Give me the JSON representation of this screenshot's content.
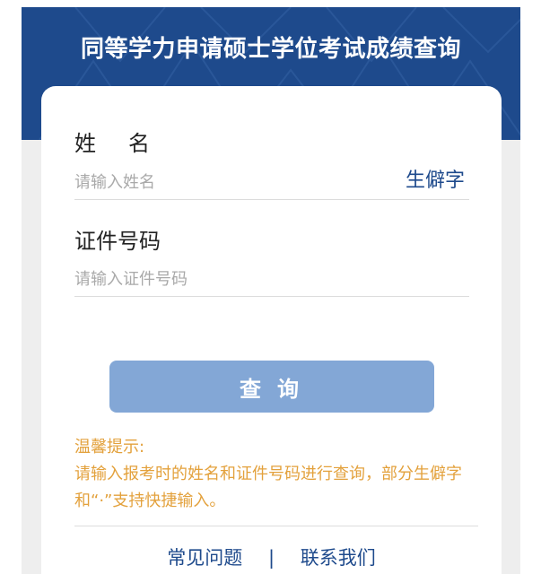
{
  "header": {
    "title": "同等学力申请硕士学位考试成绩查询"
  },
  "form": {
    "name_label": "姓名",
    "name_placeholder": "请输入姓名",
    "rare_char_label": "生僻字",
    "id_label": "证件号码",
    "id_placeholder": "请输入证件号码",
    "query_button": "查询"
  },
  "tips": {
    "title": "温馨提示:",
    "text": "请输入报考时的姓名和证件号码进行查询，部分生僻字和“·”支持快捷输入。"
  },
  "footer": {
    "faq": "常见问题",
    "separator": "|",
    "contact": "联系我们"
  },
  "colors": {
    "banner": "#1e4a8c",
    "button": "#83a7d6",
    "tip": "#e3a13c",
    "link": "#1e4a8c"
  }
}
